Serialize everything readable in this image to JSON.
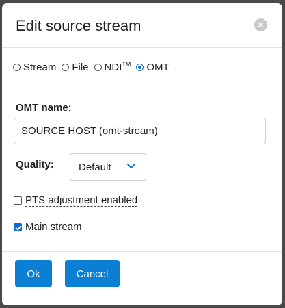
{
  "dialog": {
    "title": "Edit source stream",
    "close_icon": "close-icon"
  },
  "source_type": {
    "options": [
      "Stream",
      "File",
      "NDI",
      "OMT"
    ],
    "ndi_trademark": "TM",
    "selected": "OMT"
  },
  "omt_name": {
    "label": "OMT name:",
    "value": "SOURCE HOST (omt-stream)"
  },
  "quality": {
    "label": "Quality:",
    "selected": "Default"
  },
  "pts_adjustment": {
    "label": "PTS adjustment enabled",
    "checked": false
  },
  "main_stream": {
    "label": "Main stream",
    "checked": true
  },
  "footer": {
    "ok_label": "Ok",
    "cancel_label": "Cancel"
  },
  "colors": {
    "accent": "#0a7fd3",
    "close_bg": "#c9c9c9"
  }
}
